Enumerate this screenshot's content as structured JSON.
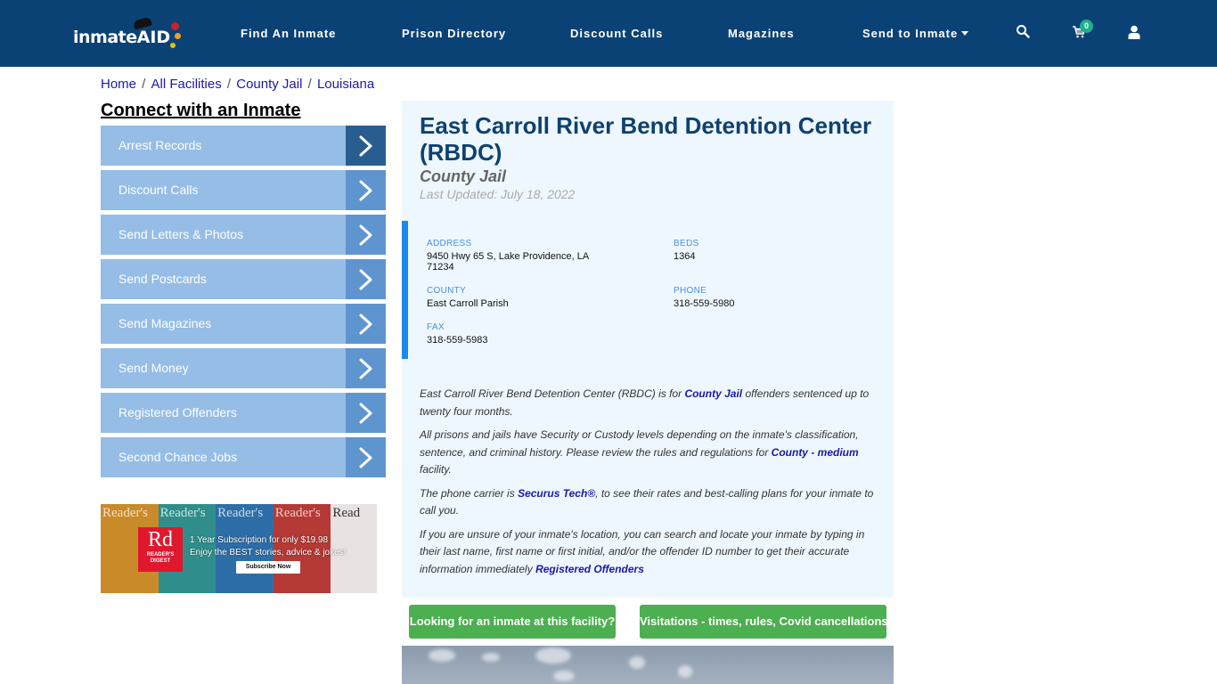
{
  "brand": {
    "logo_text": "inmate",
    "logo_accent": "AID",
    "colors": {
      "navbar": "#0b4275",
      "menu_item": "#95bde6",
      "menu_arrow": "#5f95cf",
      "menu_arrow_active": "#2a5d8f",
      "panel_bg": "#eef7fe",
      "accent_bar": "#1a8be8",
      "green_button": "#4caf50",
      "link": "#1a1aa6",
      "title": "#0e4170"
    }
  },
  "nav": {
    "items": [
      {
        "label": "Find An Inmate"
      },
      {
        "label": "Prison Directory"
      },
      {
        "label": "Discount Calls"
      },
      {
        "label": "Magazines"
      },
      {
        "label": "Send to Inmate",
        "has_dropdown": true
      }
    ],
    "icons": [
      "search-icon",
      "cart-icon",
      "user-icon"
    ],
    "cart_count": "0"
  },
  "breadcrumb": [
    {
      "label": "Home"
    },
    {
      "label": "All Facilities"
    },
    {
      "label": "County Jail"
    },
    {
      "label": "Louisiana"
    }
  ],
  "sidebar": {
    "title": "Connect with an Inmate",
    "items": [
      {
        "label": "Arrest Records",
        "active": true
      },
      {
        "label": "Discount Calls"
      },
      {
        "label": "Send Letters & Photos"
      },
      {
        "label": "Send Postcards"
      },
      {
        "label": "Send Magazines"
      },
      {
        "label": "Send Money"
      },
      {
        "label": "Registered Offenders"
      },
      {
        "label": "Second Chance Jobs"
      }
    ],
    "ad": {
      "covers": [
        "Reader's",
        "Reader's",
        "Reader's",
        "Reader's",
        "Read"
      ],
      "brand_mark": "Rd",
      "brand_name_line1": "READER'S",
      "brand_name_line2": "DIGEST",
      "line1": "1 Year Subscription for only $19.98",
      "line2": "Enjoy the BEST stories, advice & jokes!",
      "button": "Subscribe Now"
    }
  },
  "facility": {
    "name": "East Carroll River Bend Detention Center (RBDC)",
    "type": "County Jail",
    "last_updated": "Last Updated: July 18, 2022",
    "fields": {
      "address": {
        "label": "ADDRESS",
        "value_line1": "9450 Hwy 65 S, Lake Providence, LA",
        "value_line2": "71234"
      },
      "beds": {
        "label": "BEDS",
        "value": "1364"
      },
      "county": {
        "label": "COUNTY",
        "value": "East Carroll Parish"
      },
      "phone": {
        "label": "PHONE",
        "value": "318-559-5980"
      },
      "fax": {
        "label": "FAX",
        "value": "318-559-5983"
      }
    },
    "paragraphs": {
      "p1_a": "East Carroll River Bend Detention Center (RBDC) is for ",
      "p1_link": "County Jail",
      "p1_b": " offenders sentenced up to twenty four months.",
      "p2_a": "All prisons and jails have Security or Custody levels depending on the inmate's classification, sentence, and criminal history. Please review the rules and regulations for ",
      "p2_link": "County - medium",
      "p2_b": " facility.",
      "p3_a": "The phone carrier is ",
      "p3_link": "Securus Tech®",
      "p3_b": ", to see their rates and best-calling plans for your inmate to call you.",
      "p4_a": "If you are unsure of your inmate's location, you can search and locate your inmate by typing in their last name, first name or first initial, and/or the offender ID number to get their accurate information immediately ",
      "p4_link": "Registered Offenders"
    },
    "buttons": {
      "find_inmate": "Looking for an inmate at this facility?",
      "visitations": "Visitations - times, rules, Covid cancellations"
    }
  }
}
